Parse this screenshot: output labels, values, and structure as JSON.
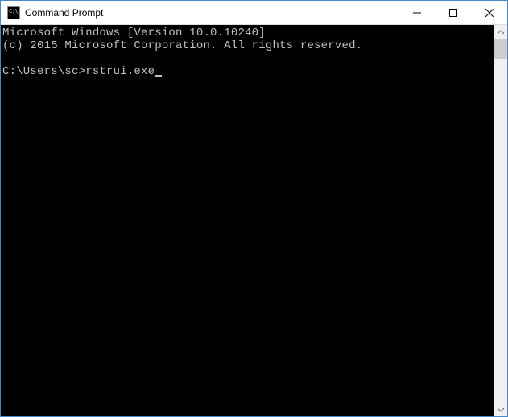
{
  "window": {
    "title": "Command Prompt"
  },
  "console": {
    "lines": {
      "l0": "Microsoft Windows [Version 10.0.10240]",
      "l1": "(c) 2015 Microsoft Corporation. All rights reserved."
    },
    "prompt": "C:\\Users\\sc>",
    "input": "rstrui.exe"
  }
}
